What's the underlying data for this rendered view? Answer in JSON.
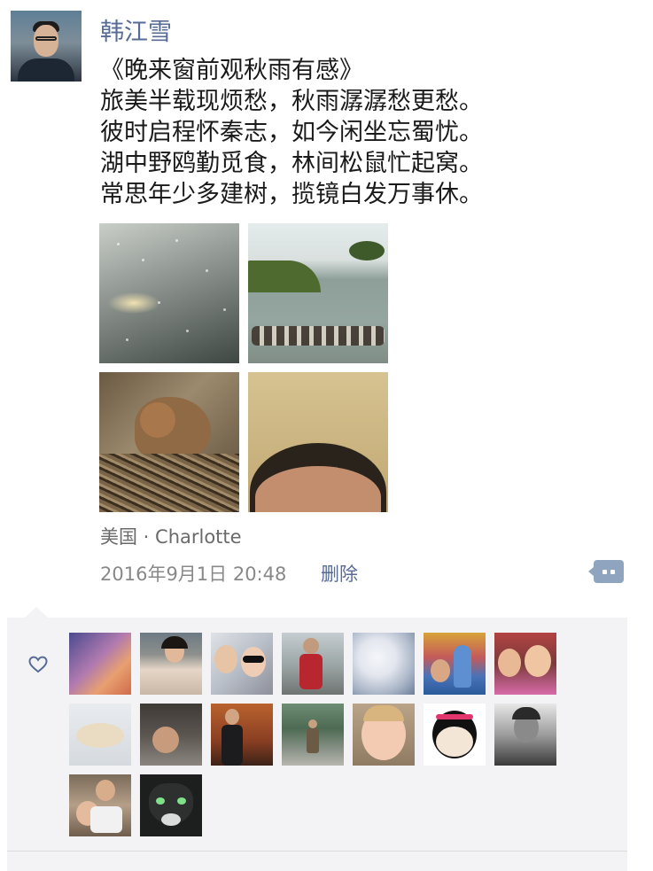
{
  "post": {
    "username": "韩江雪",
    "title": "《晚来窗前观秋雨有感》",
    "lines": [
      "旅美半载现烦愁，秋雨潺潺愁更愁。",
      "彼时启程怀秦志，如今闲坐忘蜀忧。",
      "湖中野鸥勤觅食，林间松鼠忙起窝。",
      "常思年少多建树，揽镜白发万事休。"
    ],
    "location": "美国 · Charlotte",
    "timestamp": "2016年9月1日 20:48",
    "delete_label": "删除"
  },
  "colors": {
    "link": "#576b95",
    "likes_background": "#f3f3f5",
    "comment_button": "#8fa4bf"
  },
  "icons": {
    "like": "heart-outline-icon",
    "comment": "comment-dots-icon"
  },
  "like_count": 16
}
